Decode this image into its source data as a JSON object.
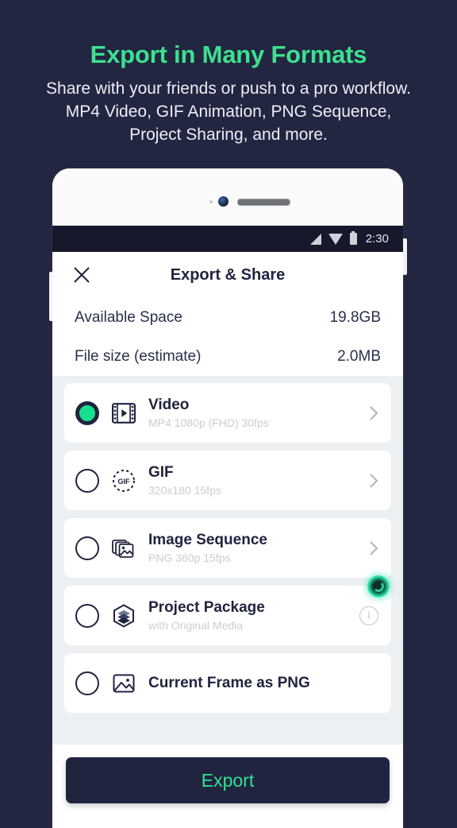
{
  "promo": {
    "title": "Export in Many Formats",
    "subtitle_lines": [
      "Share with your friends or push to a pro workflow.",
      "MP4 Video, GIF Animation, PNG Sequence,",
      "Project Sharing, and more."
    ]
  },
  "colors": {
    "page_background": "#222641",
    "accent_green": "#3DE08F",
    "radio_green": "#16E08D",
    "dark_navy": "#20243F",
    "list_background": "#EDF0F2",
    "subtitle_grey": "#C9CDD4"
  },
  "status_bar": {
    "signal_icon": "signal-icon",
    "wifi_icon": "wifi-icon",
    "battery_icon": "battery-icon",
    "time": "2:30"
  },
  "app_bar": {
    "close_icon": "close-icon",
    "title": "Export & Share"
  },
  "info_rows": [
    {
      "label": "Available Space",
      "value": "19.8GB"
    },
    {
      "label": "File size (estimate)",
      "value": "2.0MB"
    }
  ],
  "options": [
    {
      "title": "Video",
      "subtitle": "MP4 1080p (FHD) 30fps",
      "icon": "film-strip-icon",
      "selected": true,
      "accessory": "chevron-right-icon"
    },
    {
      "title": "GIF",
      "subtitle": "320x180 15fps",
      "icon": "gif-icon",
      "selected": false,
      "accessory": "chevron-right-icon"
    },
    {
      "title": "Image Sequence",
      "subtitle": "PNG 360p 15fps",
      "icon": "image-stack-icon",
      "selected": false,
      "accessory": "chevron-right-icon"
    },
    {
      "title": "Project Package",
      "subtitle": "with Original Media",
      "icon": "layers-hexagon-icon",
      "selected": false,
      "accessory": "info-icon"
    },
    {
      "title": "Current Frame as PNG",
      "subtitle": "",
      "icon": "image-icon",
      "selected": false,
      "accessory": ""
    }
  ],
  "gif_icon_label": "GIF",
  "info_icon_glyph": "i",
  "tap_indicator": "tap-highlight-badge",
  "footer": {
    "export_label": "Export"
  }
}
